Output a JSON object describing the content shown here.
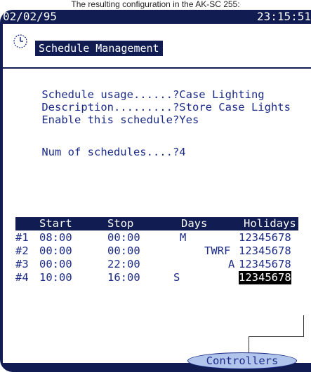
{
  "caption": "The resulting configuration in the AK-SC 255:",
  "topbar": {
    "date": "02/02/95",
    "time": "23:15:51"
  },
  "screen_title": "Schedule Management",
  "fields": [
    {
      "label": "Schedule usage......?",
      "value": "Case Lighting"
    },
    {
      "label": "Description.........?",
      "value": "Store Case Lights"
    },
    {
      "label": "Enable this schedule?",
      "value": "Yes"
    },
    {
      "label": "Num of schedules....?",
      "value": "4"
    }
  ],
  "table": {
    "headers": [
      "Start",
      "Stop",
      "Days",
      "Holidays"
    ],
    "rows": [
      {
        "num": "#1",
        "start": "08:00",
        "stop": "00:00",
        "days": "M",
        "holidays": "12345678"
      },
      {
        "num": "#2",
        "start": "00:00",
        "stop": "00:00",
        "days": "TWRF",
        "holidays": "12345678"
      },
      {
        "num": "#3",
        "start": "00:00",
        "stop": "22:00",
        "days": "A",
        "holidays": "12345678"
      },
      {
        "num": "#4",
        "start": "10:00",
        "stop": "16:00",
        "days": "S",
        "holidays": "12345678"
      }
    ],
    "selected_cell": "row 4 holidays"
  },
  "controllers_button": "Controllers",
  "icons": {
    "clock": "clock-icon"
  },
  "colors": {
    "bar": "#101c52",
    "text": "#1c2c86",
    "button_fill": "#b0c4ec",
    "highlight": "#000000"
  }
}
